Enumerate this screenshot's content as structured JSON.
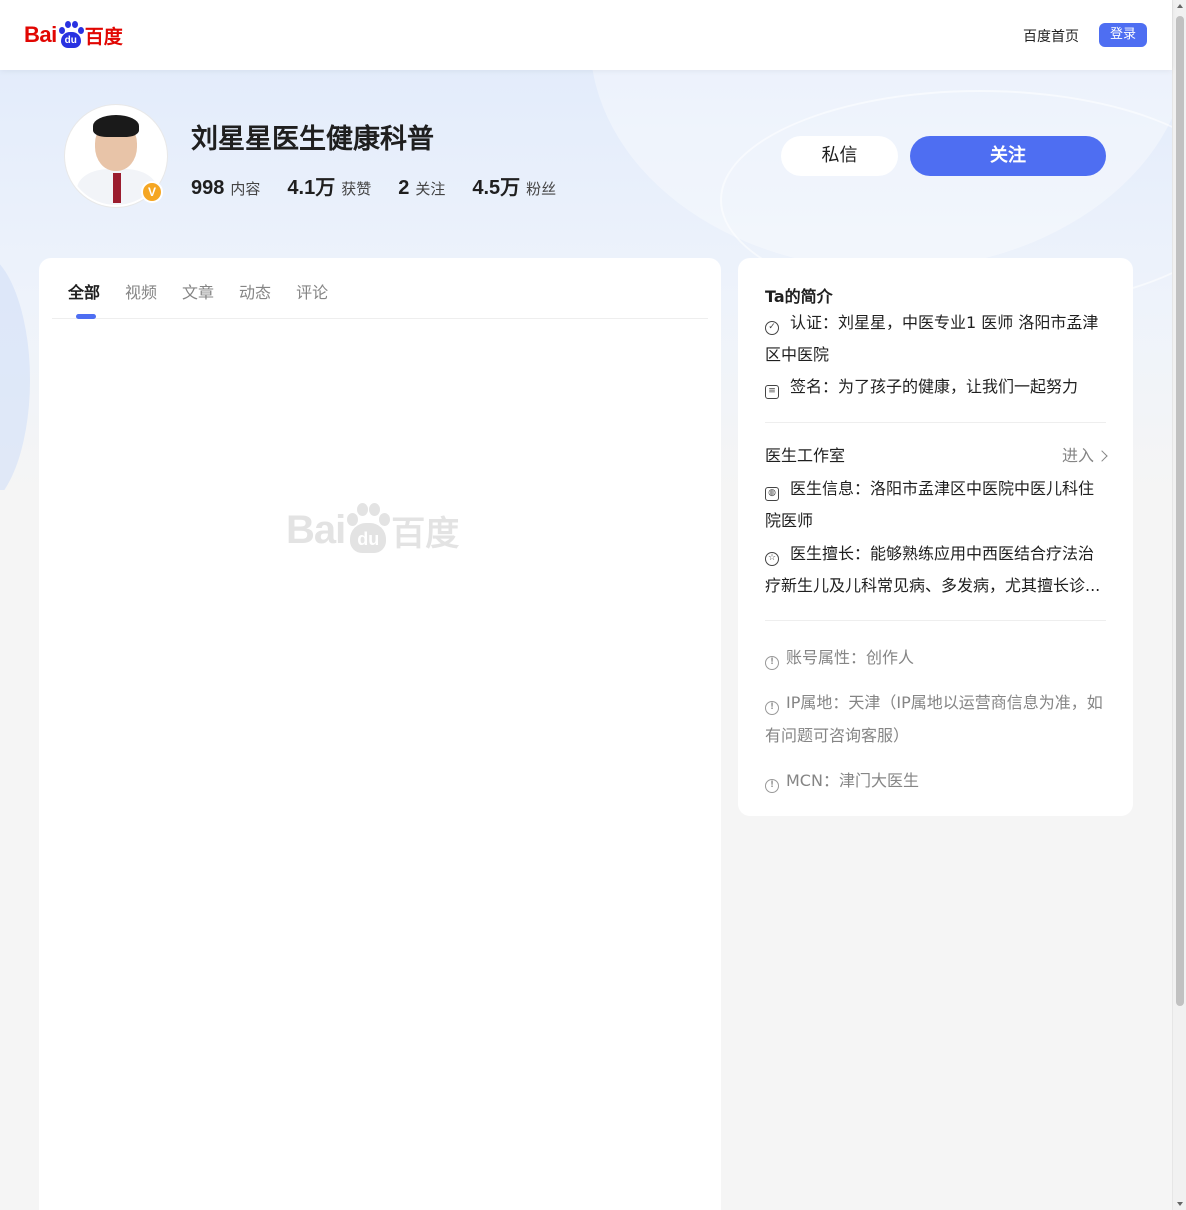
{
  "header": {
    "logo_latin": "Bai",
    "logo_paw_text": "du",
    "logo_cn": "百度",
    "home_link": "百度首页",
    "login_button": "登录"
  },
  "profile": {
    "name": "刘星星医生健康科普",
    "verified_badge": "V",
    "stats": [
      {
        "value": "998",
        "label": "内容"
      },
      {
        "value": "4.1万",
        "label": "获赞"
      },
      {
        "value": "2",
        "label": "关注"
      },
      {
        "value": "4.5万",
        "label": "粉丝"
      }
    ],
    "message_button": "私信",
    "follow_button": "关注"
  },
  "tabs": [
    "全部",
    "视频",
    "文章",
    "动态",
    "评论"
  ],
  "active_tab": "全部",
  "loading_logo": {
    "latin": "Bai",
    "paw_text": "du",
    "cn": "百度"
  },
  "intro": {
    "title": "Ta的简介",
    "certification": "认证：刘星星，中医专业1 医师 洛阳市孟津区中医院",
    "signature": "签名：为了孩子的健康，让我们一起努力"
  },
  "studio": {
    "title": "医生工作室",
    "enter": "进入",
    "doctor_info": "医生信息：洛阳市孟津区中医院中医儿科住院医师",
    "specialty": "医生擅长：能够熟练应用中西医结合疗法治疗新生儿及儿科常见病、多发病，尤其擅长诊..."
  },
  "account": {
    "attribute": "账号属性：创作人",
    "ip_location": "IP属地：天津（IP属地以运营商信息为准，如有问题可咨询客服）",
    "mcn": "MCN：津门大医生"
  },
  "colors": {
    "accent": "#4e6ef2",
    "baidu_red": "#e10602",
    "baidu_blue": "#2932e1",
    "verified_badge": "#f5a623"
  },
  "icons": {
    "cert": "verified-check-icon",
    "sign": "note-icon",
    "doctor": "doctor-icon",
    "specialty": "star-icon",
    "meta": "info-circle-icon",
    "enter": "chevron-right-icon"
  }
}
